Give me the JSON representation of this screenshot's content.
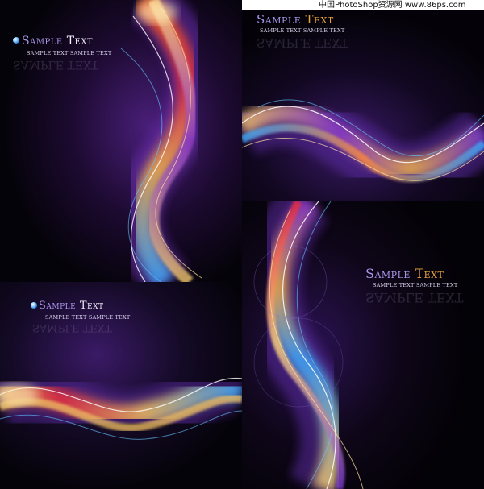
{
  "watermark": "中国PhotoShop资源网 www.86ps.com",
  "panels": [
    {
      "title_word1": "Sample",
      "title_word2": "Text",
      "subtitle": "SAMPLE TEXT   SAMPLE TEXT",
      "reflection": "SAMPLE TEXT",
      "bullet_icon": "blue-orb-icon"
    },
    {
      "title_word1": "Sample",
      "title_word2": "Text",
      "subtitle": "SAMPLE TEXT   SAMPLE TEXT",
      "reflection": "SAMPLE TEXT"
    },
    {
      "title_word1": "Sample",
      "title_word2": "Text",
      "subtitle": "SAMPLE TEXT   SAMPLE TEXT",
      "reflection": "SAMPLE TEXT",
      "bullet_icon": "blue-orb-icon"
    },
    {
      "title_word1": "Sample",
      "title_word2": "Text",
      "subtitle": "SAMPLE TEXT   SAMPLE TEXT",
      "reflection": "SAMPLE TEXT"
    }
  ],
  "colors": {
    "background": "#07040c",
    "purple": "#5a2a9a",
    "gold": "#f0c060",
    "blue": "#3aa8ff",
    "red": "#e83040"
  }
}
